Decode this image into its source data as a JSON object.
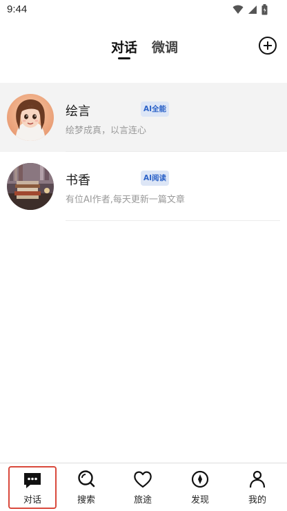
{
  "status_bar": {
    "time": "9:44",
    "icons": [
      "wifi-icon",
      "signal-icon",
      "battery-icon"
    ]
  },
  "top_tabs": {
    "active": "对话",
    "inactive": "微调",
    "add_icon": "add-circle-icon"
  },
  "chats": [
    {
      "name": "绘言",
      "badge": "AI全能",
      "desc": "绘梦成真，以言连心",
      "avatar": "girl-avatar",
      "highlighted": true
    },
    {
      "name": "书香",
      "badge": "AI阅读",
      "desc": "有位AI作者,每天更新一篇文章",
      "avatar": "books-avatar",
      "highlighted": false
    }
  ],
  "bottom_nav": [
    {
      "label": "对话",
      "icon": "chat-icon",
      "active": true
    },
    {
      "label": "搜索",
      "icon": "search-icon",
      "active": false
    },
    {
      "label": "旅途",
      "icon": "heart-icon",
      "active": false
    },
    {
      "label": "发现",
      "icon": "compass-icon",
      "active": false
    },
    {
      "label": "我的",
      "icon": "person-icon",
      "active": false
    }
  ],
  "colors": {
    "badge_bg": "#dde6f6",
    "badge_text": "#2d63c8",
    "active_outline": "#d9483b",
    "highlight_row": "#f3f3f3"
  }
}
